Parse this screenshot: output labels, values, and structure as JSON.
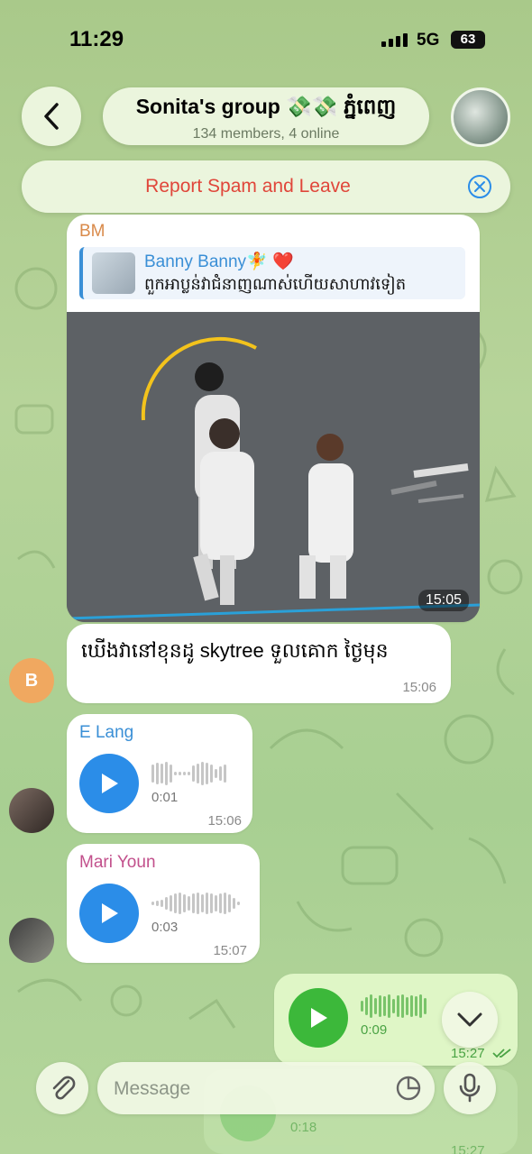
{
  "status_bar": {
    "time": "11:29",
    "network": "5G",
    "battery": "63"
  },
  "header": {
    "title": "Sonita's group 💸💸 ភ្នំពេញ",
    "subtitle": "134 members, 4 online"
  },
  "spam_bar": {
    "label": "Report Spam and Leave"
  },
  "messages": [
    {
      "sender": "BM",
      "sender_color": "#d98a4a",
      "reply": {
        "name": "Banny Banny🧚 ❤️",
        "text": "ពួកអាប្លន់វាជំនាញណាស់ហើយសាហាវទៀត"
      },
      "photo_time": "15:05",
      "text": "ឃើងវានៅខុនដូ skytree ទួលគោក ថ្ងៃមុន",
      "time": "15:06",
      "avatar_letter": "B",
      "avatar_color": "#f0a860"
    },
    {
      "sender": "E Lang",
      "sender_color": "#3a8fd6",
      "duration": "0:01",
      "time": "15:06"
    },
    {
      "sender": "Mari Youn",
      "sender_color": "#c2508c",
      "duration": "0:03",
      "time": "15:07"
    },
    {
      "duration": "0:09",
      "time": "15:27"
    }
  ],
  "ghost_message": {
    "duration": "0:18",
    "time": "15:27"
  },
  "composer": {
    "placeholder": "Message"
  },
  "colors": {
    "accent_blue": "#2b8de8",
    "accent_green": "#3cb83a",
    "alert_red": "#e0463a"
  }
}
